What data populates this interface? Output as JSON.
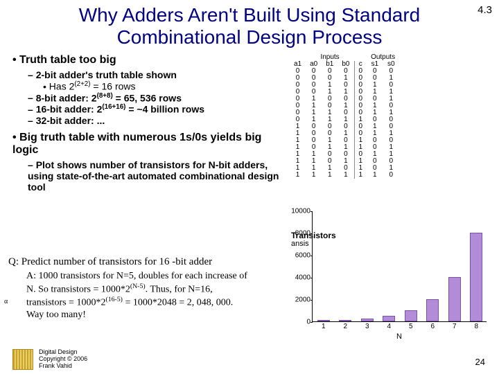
{
  "slide_number_top": "4.3",
  "title": "Why Adders Aren't Built Using Standard Combinational Design Process",
  "bullets": {
    "b1a": "Truth table too big",
    "b2a": "2-bit adder's truth table shown",
    "b3a_pre": "Has 2",
    "b3a_sup": "(2+2)",
    "b3a_post": " = 16 rows",
    "b2b_pre": "8-bit adder: 2",
    "b2b_sup": "(8+8)",
    "b2b_post": " = 65, 536 rows",
    "b2c_pre": "16-bit adder: 2",
    "b2c_sup": "(16+16)",
    "b2c_post": " = ~4 billion rows",
    "b2d": "32-bit adder: ...",
    "b1b": "Big truth table with numerous 1s/0s yields big logic",
    "b2e": "Plot shows number of transistors for N-bit adders, using state-of-the-art automated combinational design tool"
  },
  "qa": {
    "q": "Q: Predict number of transistors for 16 -bit adder",
    "a_label": "α",
    "a_pre": "A: 1000 transistors for N=5, doubles for each increase of N. So transistors = 1000*2",
    "a_sup1": "(N-5)",
    "a_mid": ". Thus, for N=16, transistors = 1000*2",
    "a_sup2": "(16-5)",
    "a_post": " = 1000*2048 = 2, 048, 000.   Way too many!"
  },
  "truth_table": {
    "group_inputs": "Inputs",
    "group_outputs": "Outputs",
    "headers": [
      "a1",
      "a0",
      "b1",
      "b0",
      "c",
      "s1",
      "s0"
    ],
    "rows": [
      [
        "0",
        "0",
        "0",
        "0",
        "0",
        "0",
        "0"
      ],
      [
        "0",
        "0",
        "0",
        "1",
        "0",
        "0",
        "1"
      ],
      [
        "0",
        "0",
        "1",
        "0",
        "0",
        "1",
        "0"
      ],
      [
        "0",
        "0",
        "1",
        "1",
        "0",
        "1",
        "1"
      ],
      [
        "0",
        "1",
        "0",
        "0",
        "0",
        "0",
        "1"
      ],
      [
        "0",
        "1",
        "0",
        "1",
        "0",
        "1",
        "0"
      ],
      [
        "0",
        "1",
        "1",
        "0",
        "0",
        "1",
        "1"
      ],
      [
        "0",
        "1",
        "1",
        "1",
        "1",
        "0",
        "0"
      ],
      [
        "1",
        "0",
        "0",
        "0",
        "0",
        "1",
        "0"
      ],
      [
        "1",
        "0",
        "0",
        "1",
        "0",
        "1",
        "1"
      ],
      [
        "1",
        "0",
        "1",
        "0",
        "1",
        "0",
        "0"
      ],
      [
        "1",
        "0",
        "1",
        "1",
        "1",
        "0",
        "1"
      ],
      [
        "1",
        "1",
        "0",
        "0",
        "0",
        "1",
        "1"
      ],
      [
        "1",
        "1",
        "0",
        "1",
        "1",
        "0",
        "0"
      ],
      [
        "1",
        "1",
        "1",
        "0",
        "1",
        "0",
        "1"
      ],
      [
        "1",
        "1",
        "1",
        "1",
        "1",
        "1",
        "0"
      ]
    ]
  },
  "chart_data": {
    "type": "bar",
    "categories": [
      "1",
      "2",
      "3",
      "4",
      "5",
      "6",
      "7",
      "8"
    ],
    "values": [
      80,
      150,
      250,
      500,
      1000,
      2000,
      4000,
      8000
    ],
    "title": "",
    "xlabel": "N",
    "ylabel": "Transistors",
    "ylabel_sub": "ansis",
    "yticks": [
      0,
      2000,
      4000,
      6000,
      8000,
      10000
    ],
    "ylim": [
      0,
      10000
    ]
  },
  "footer": {
    "line1": "Digital Design",
    "line2": "Copyright © 2006",
    "line3": "Frank Vahid"
  },
  "page_number": "24"
}
